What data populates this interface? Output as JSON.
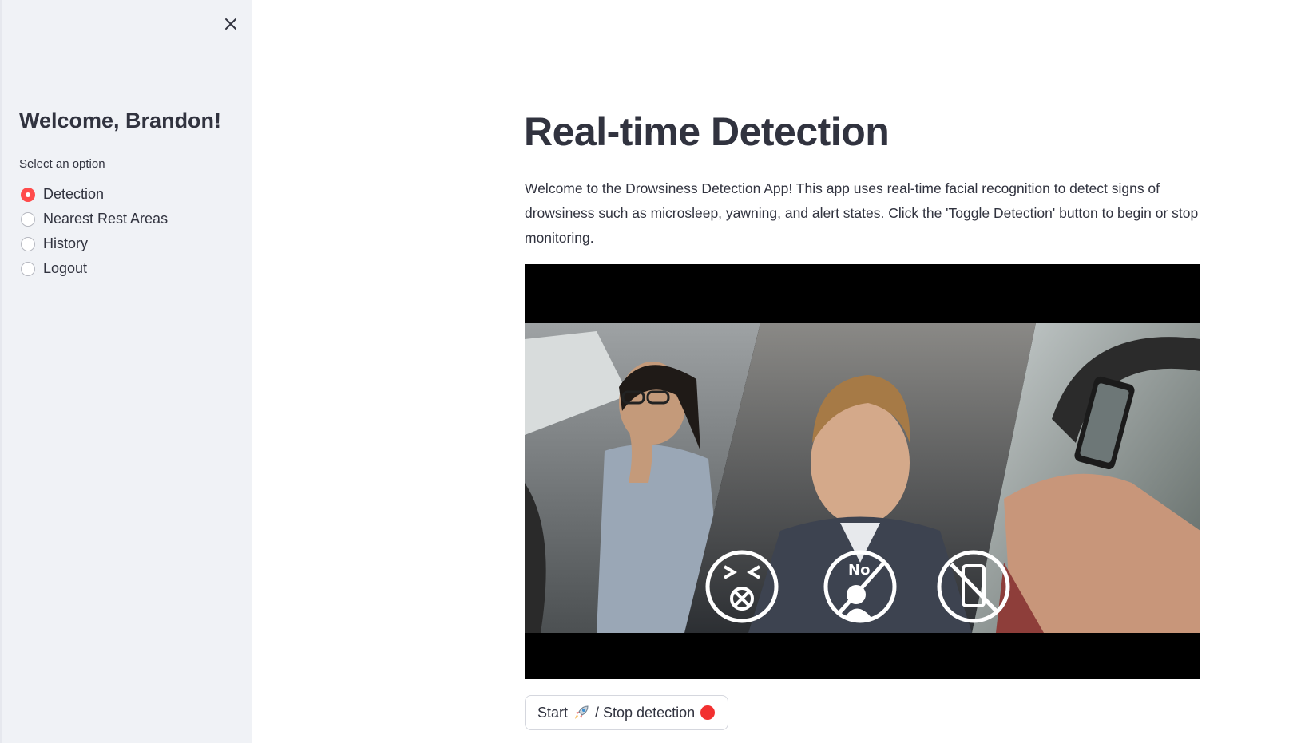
{
  "sidebar": {
    "title": "Welcome, Brandon!",
    "radio_label": "Select an option",
    "options": [
      {
        "label": "Detection",
        "selected": true
      },
      {
        "label": "Nearest Rest Areas",
        "selected": false
      },
      {
        "label": "History",
        "selected": false
      },
      {
        "label": "Logout",
        "selected": false
      }
    ],
    "close_icon": "close-icon"
  },
  "main": {
    "title": "Real-time Detection",
    "description": "Welcome to the Drowsiness Detection App! This app uses real-time facial recognition to detect signs of drowsiness such as microsleep, yawning, and alert states. Click the 'Toggle Detection' button to begin or stop monitoring.",
    "video": {
      "icons": [
        "yawning-icon",
        "no-sleep-icon",
        "no-phone-icon"
      ]
    },
    "button": {
      "start_text": "Start",
      "rocket_icon": "rocket-icon",
      "stop_text": "/ Stop detection",
      "dot_icon": "red-dot-icon"
    }
  },
  "colors": {
    "accent": "#ff4b4b",
    "sidebar_bg": "#f0f2f6",
    "text": "#31333f"
  }
}
